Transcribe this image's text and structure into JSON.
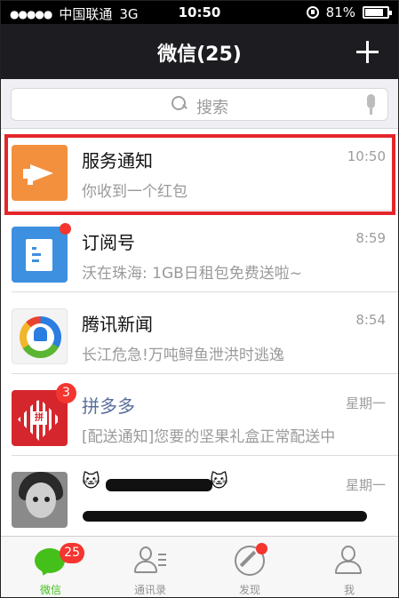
{
  "status_bar": {
    "signal": "●●●●●",
    "carrier": "中国联通",
    "network": "3G",
    "time": "10:50",
    "battery": "81%"
  },
  "nav": {
    "title": "微信(25)",
    "add_icon": "plus-icon"
  },
  "search": {
    "placeholder": "搜索",
    "icon": "search-icon",
    "voice_icon": "microphone-icon"
  },
  "chats": [
    {
      "name": "服务通知",
      "time": "10:50",
      "message": "你收到一个红包",
      "avatar": "megaphone-icon",
      "avatar_color": "#f3903e",
      "highlighted": true
    },
    {
      "name": "订阅号",
      "time": "8:59",
      "message": "沃在珠海: 1GB日租包免费送啦~",
      "avatar": "document-icon",
      "avatar_color": "#3d8fe0",
      "unread_dot": true
    },
    {
      "name": "腾讯新闻",
      "time": "8:54",
      "message": "长江危急!万吨鲟鱼泄洪时逃逸",
      "avatar": "tencent-news-icon"
    },
    {
      "name": "拼多多",
      "time": "星期一",
      "message": "[配送通知]您要的坚果礼盒正常配送中",
      "avatar": "pinduoduo-logo",
      "avatar_color": "#d6262d",
      "unread_count": "3"
    },
    {
      "name_left": "🐱",
      "name_right": "🐱",
      "time": "星期一",
      "avatar": "person-avatar",
      "redacted": true
    }
  ],
  "tabbar": {
    "tabs": [
      {
        "label": "微信",
        "icon": "chat-bubble-icon",
        "badge": "25",
        "active": true
      },
      {
        "label": "通讯录",
        "icon": "contacts-icon"
      },
      {
        "label": "发现",
        "icon": "compass-icon",
        "dot": true
      },
      {
        "label": "我",
        "icon": "person-icon"
      }
    ]
  },
  "colors": {
    "accent": "#45c01a",
    "badge": "#f43530",
    "highlight_border": "#e4262b",
    "nav_bg": "#1d1c21"
  }
}
